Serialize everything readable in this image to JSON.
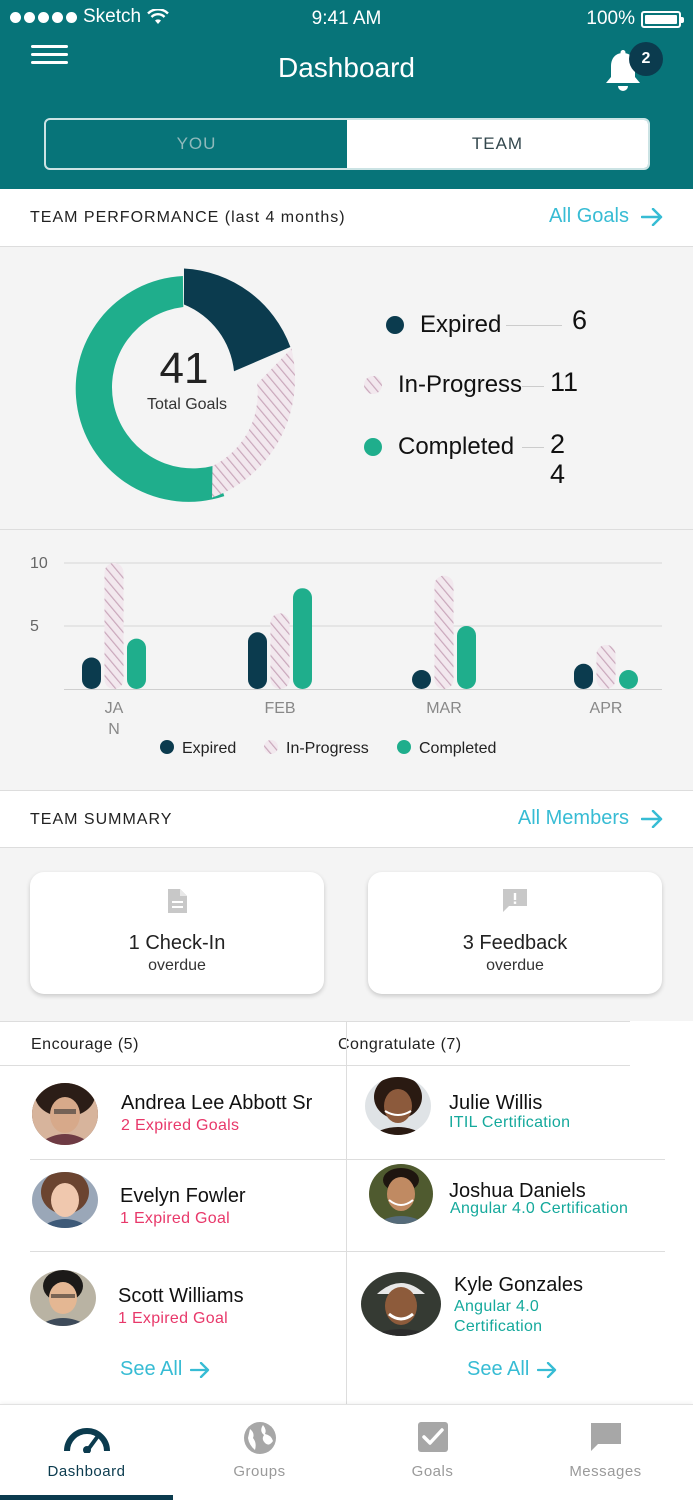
{
  "status_bar": {
    "carrier": "Sketch",
    "time": "9:41 AM",
    "battery": "100%"
  },
  "header": {
    "title": "Dashboard",
    "notification_count": "2"
  },
  "segment": {
    "you": "YOU",
    "team": "TEAM",
    "selected": "TEAM"
  },
  "performance": {
    "title": "TEAM PERFORMANCE (last 4 months)",
    "link": "All Goals",
    "total": "41",
    "total_label": "Total Goals",
    "legend": [
      {
        "label": "Expired",
        "value": "6",
        "color": "#0b3b4e"
      },
      {
        "label": "In-Progress",
        "value": "11",
        "color": "#d9b9cc"
      },
      {
        "label": "Completed",
        "value_line1": "2",
        "value_line2": "4",
        "color": "#1fae8c"
      }
    ]
  },
  "chart_data": {
    "type": "bar",
    "categories": [
      "JAN",
      "FEB",
      "MAR",
      "APR"
    ],
    "category_labels": [
      [
        "JA",
        "N"
      ],
      [
        "FEB"
      ],
      [
        "MAR"
      ],
      [
        "APR"
      ]
    ],
    "series": [
      {
        "name": "Expired",
        "values": [
          2.5,
          4.5,
          1.5,
          2
        ],
        "color": "#0b3b4e"
      },
      {
        "name": "In-Progress",
        "values": [
          10,
          6,
          9,
          3.5
        ],
        "color": "#d9b9cc"
      },
      {
        "name": "Completed",
        "values": [
          4,
          8,
          5,
          1.5
        ],
        "color": "#1fae8c"
      }
    ],
    "y_ticks": [
      "10",
      "5"
    ],
    "ylim": [
      0,
      10
    ],
    "grid": true,
    "legend_placement": "bottom"
  },
  "summary": {
    "title": "TEAM SUMMARY",
    "link": "All Members",
    "cards": [
      {
        "main": "1 Check-In",
        "sub": "overdue",
        "icon": "document-icon"
      },
      {
        "main": "3 Feedback",
        "sub": "overdue",
        "icon": "feedback-icon"
      }
    ]
  },
  "encourage": {
    "header": "Encourage (5)",
    "people": [
      {
        "name": "Andrea Lee Abbott Sr",
        "sub": "2 Expired Goals"
      },
      {
        "name": "Evelyn Fowler",
        "sub": "1 Expired Goal"
      },
      {
        "name": "Scott Williams",
        "sub": "1 Expired Goal"
      }
    ],
    "see_all": "See All"
  },
  "congratulate": {
    "header": "Congratulate (7)",
    "people": [
      {
        "name": "Julie Willis",
        "sub": "ITIL Certification"
      },
      {
        "name": "Joshua Daniels",
        "sub": "Angular 4.0 Certification"
      },
      {
        "name": "Kyle Gonzales",
        "sub_line1": "Angular 4.0",
        "sub_line2": "Certification"
      }
    ],
    "see_all": "See All"
  },
  "tabs": [
    {
      "label": "Dashboard",
      "icon": "gauge-icon",
      "active": true
    },
    {
      "label": "Groups",
      "icon": "globe-icon",
      "active": false
    },
    {
      "label": "Goals",
      "icon": "checkbox-icon",
      "active": false
    },
    {
      "label": "Messages",
      "icon": "message-icon",
      "active": false
    }
  ]
}
